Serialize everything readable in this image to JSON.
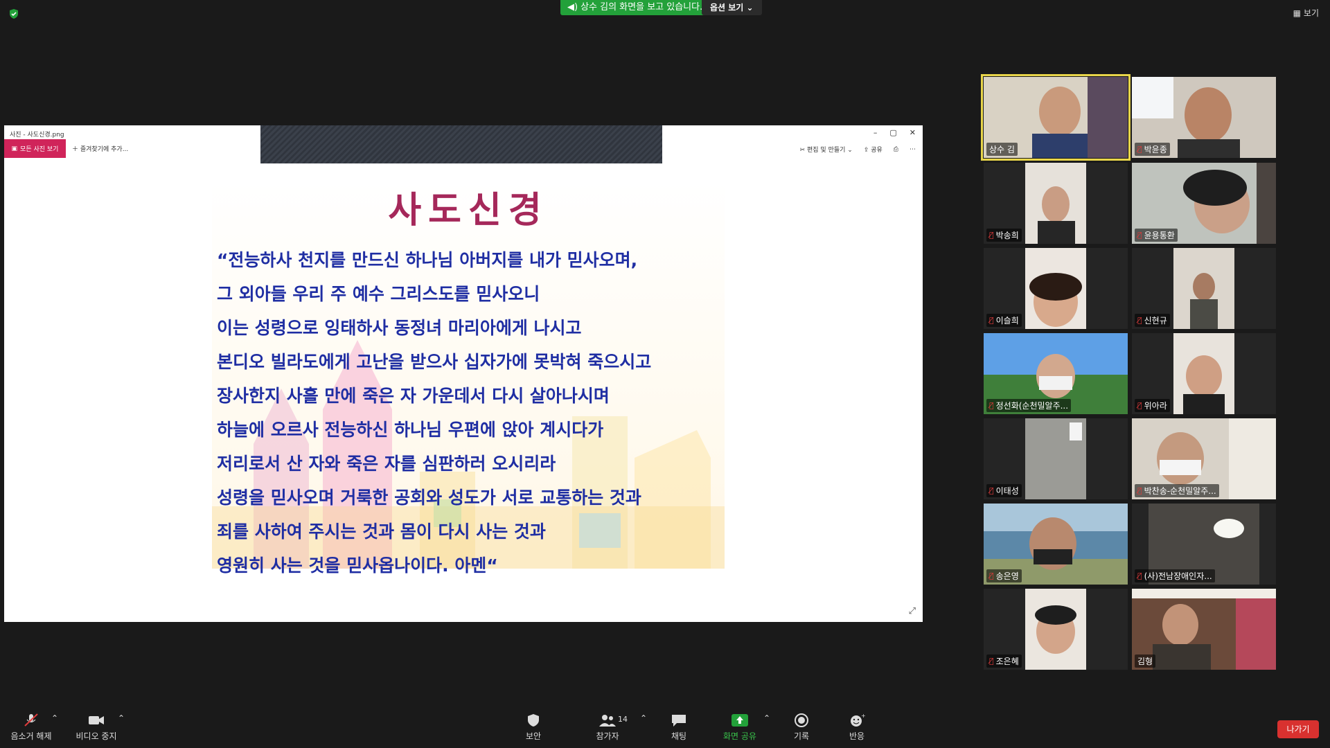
{
  "topbar": {
    "share_banner": "상수 김의 화면을 보고 있습니다.",
    "options_label": "옵션 보기 ⌄",
    "view_label": "보기"
  },
  "shared_window": {
    "title": "사진 - 사도신경.png",
    "all_photos_label": "모든 사진 보기",
    "add_favorite_label": "즐겨찾기에 추가...",
    "edit_label": "편집 및 만들기 ⌄",
    "share_label": "공유",
    "controls": [
      "–",
      "▢",
      "✕"
    ]
  },
  "slide": {
    "title": "사도신경",
    "lines": [
      "“전능하사 천지를 만드신 하나님 아버지를 내가 믿사오며,",
      "그 외아들 우리 주 예수 그리스도를 믿사오니",
      "이는 성령으로 잉태하사 동정녀 마리아에게 나시고",
      "본디오 빌라도에게 고난을 받으사 십자가에 못박혀 죽으시고",
      "장사한지 사흘 만에 죽은 자 가운데서 다시 살아나시며",
      "하늘에 오르사 전능하신 하나님 우편에 앉아 계시다가",
      "저리로서 산 자와 죽은 자를 심판하러 오시리라",
      "성령을 믿사오며 거룩한 공회와 성도가 서로 교통하는 것과",
      "죄를 사하여 주시는 것과 몸이 다시 사는 것과",
      "영원히 사는 것을 믿사옵나이다. 아멘“"
    ]
  },
  "participants": [
    {
      "name": "상수 김",
      "muted": false,
      "active": true
    },
    {
      "name": "박윤종",
      "muted": true
    },
    {
      "name": "박송희",
      "muted": true
    },
    {
      "name": "윤용통환",
      "muted": true
    },
    {
      "name": "이슬희",
      "muted": true
    },
    {
      "name": "신현규",
      "muted": true
    },
    {
      "name": "정선화(순천밀알주...",
      "muted": true
    },
    {
      "name": "위아라",
      "muted": true
    },
    {
      "name": "이태성",
      "muted": true
    },
    {
      "name": "박찬송-순천밀알주...",
      "muted": true
    },
    {
      "name": "송은영",
      "muted": true
    },
    {
      "name": "(사)전남장애인자...",
      "muted": true
    },
    {
      "name": "조은혜",
      "muted": true
    },
    {
      "name": "김형",
      "muted": false
    }
  ],
  "toolbar": {
    "unmute_label": "음소거 해제",
    "stop_video_label": "비디오 중지",
    "security_label": "보안",
    "participants_label": "참가자",
    "participants_count": "14",
    "chat_label": "채팅",
    "share_screen_label": "화면 공유",
    "record_label": "기록",
    "reactions_label": "반응",
    "leave_label": "나가기"
  },
  "colors": {
    "banner_green": "#23a13a",
    "leave_red": "#d8312f",
    "active_speaker_border": "#e8d54a",
    "slide_title": "#a5285a",
    "slide_text": "#1f2ea3"
  }
}
